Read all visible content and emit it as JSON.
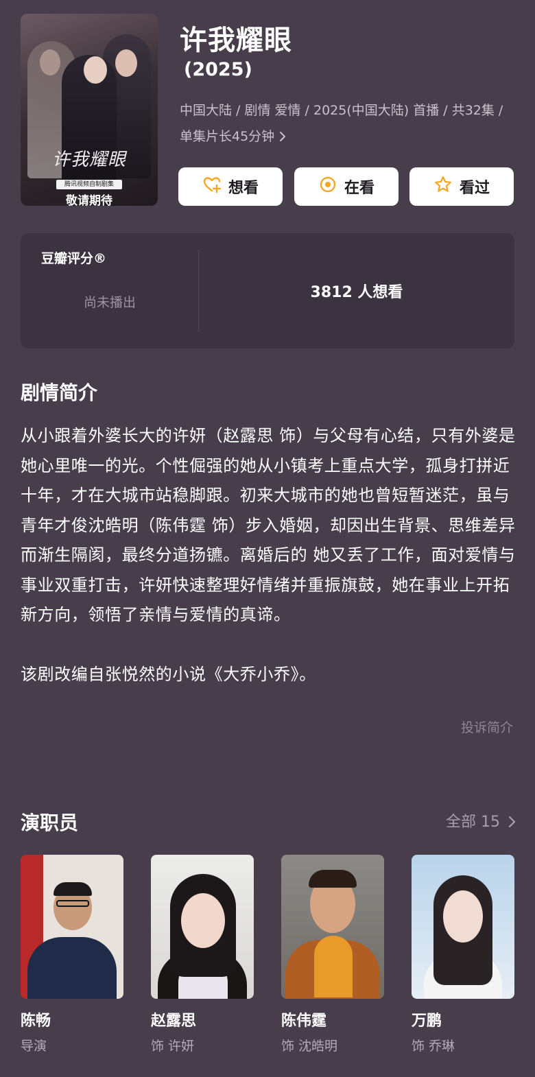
{
  "show": {
    "title": "许我耀眼",
    "year": "(2025)",
    "meta": "中国大陆 / 剧情 爱情 / 2025(中国大陆) 首播 / 共32集 / 单集片长45分钟",
    "poster": {
      "title_art": "许我耀眼",
      "tag": "腾讯视频自制剧集",
      "bottom_text": "敬请期待"
    }
  },
  "actions": [
    {
      "label": "想看",
      "icon": "heart-plus-icon",
      "color": "#f5a623"
    },
    {
      "label": "在看",
      "icon": "target-circle-icon",
      "color": "#f5a623"
    },
    {
      "label": "看过",
      "icon": "star-icon",
      "color": "#f5a623"
    }
  ],
  "rating": {
    "label": "豆瓣评分®",
    "status": "尚未播出",
    "want_count": "3812 人想看"
  },
  "synopsis": {
    "title": "剧情简介",
    "paragraph1": "从小跟着外婆长大的许妍（赵露思 饰）与父母有心结，只有外婆是她心里唯一的光。个性倔强的她从小镇考上重点大学，孤身打拼近十年，才在大城市站稳脚跟。初来大城市的她也曾短暂迷茫，虽与青年才俊沈皓明（陈伟霆 饰）步入婚姻，却因出生背景、思维差异而渐生隔阂，最终分道扬镳。离婚后的 她又丢了工作，面对爱情与事业双重打击，许妍快速整理好情绪并重振旗鼓，她在事业上开拓新方向，领悟了亲情与爱情的真谛。",
    "paragraph2": "该剧改编自张悦然的小说《大乔小乔》。",
    "report_label": "投诉简介"
  },
  "cast": {
    "title": "演职员",
    "all_label": "全部 15",
    "members": [
      {
        "name": "陈畅",
        "role": "导演"
      },
      {
        "name": "赵露思",
        "role": "饰 许妍"
      },
      {
        "name": "陈伟霆",
        "role": "饰 沈皓明"
      },
      {
        "name": "万鹏",
        "role": "饰 乔琳"
      }
    ]
  },
  "colors": {
    "background": "#473d4b",
    "card": "#3b3340",
    "accent": "#f5a623"
  }
}
